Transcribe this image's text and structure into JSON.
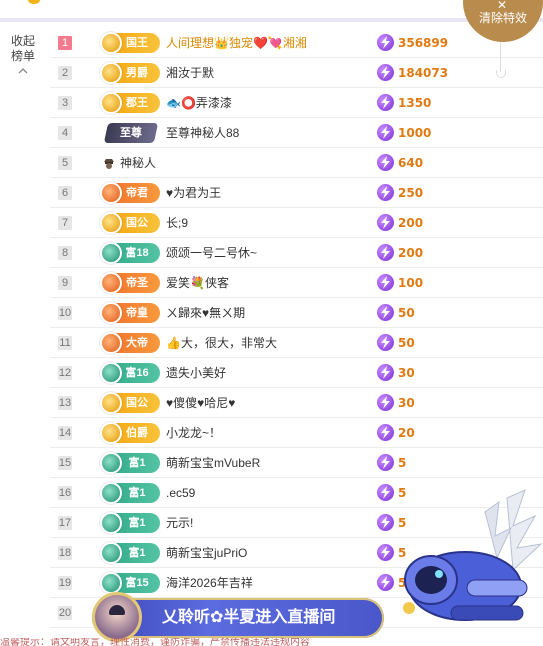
{
  "collapse_label": "收起榜单",
  "clear_effects_label": "清除特效",
  "banner_text": "乂聆听✿半夏进入直播间",
  "bottom_text": "温馨提示：请文明发言，理性消费，谨防诈骗，严禁传播违法违规内容",
  "rows": [
    {
      "rank": "1",
      "badge": "国王",
      "badge_type": "gold",
      "name": "人间理想👑独宠❤️💘湘湘",
      "score": "356899",
      "name_color": "gold"
    },
    {
      "rank": "2",
      "badge": "男爵",
      "badge_type": "gold",
      "name": "湘汝于默",
      "score": "184073"
    },
    {
      "rank": "3",
      "badge": "郡王",
      "badge_type": "gold",
      "name": "🐟⭕弄漆漆",
      "score": "1350"
    },
    {
      "rank": "4",
      "badge": "至尊",
      "badge_type": "dark",
      "name": "至尊神秘人88",
      "score": "1000"
    },
    {
      "rank": "5",
      "badge": "",
      "badge_type": "mystery",
      "name": "神秘人",
      "score": "640"
    },
    {
      "rank": "6",
      "badge": "帝君",
      "badge_type": "orange",
      "name": "♥为君为王",
      "score": "250"
    },
    {
      "rank": "7",
      "badge": "国公",
      "badge_type": "gold",
      "name": "长;9",
      "score": "200"
    },
    {
      "rank": "8",
      "badge": "富18",
      "badge_type": "teal",
      "name": "颂颂一号二号休~",
      "score": "200"
    },
    {
      "rank": "9",
      "badge": "帝圣",
      "badge_type": "orange",
      "name": "爱笑💐侠客",
      "score": "100"
    },
    {
      "rank": "10",
      "badge": "帝皇",
      "badge_type": "orange",
      "name": "ㄨ歸來♥無ㄨ期",
      "score": "50"
    },
    {
      "rank": "11",
      "badge": "大帝",
      "badge_type": "orange",
      "name": "👍大，很大，非常大",
      "score": "50"
    },
    {
      "rank": "12",
      "badge": "富16",
      "badge_type": "teal",
      "name": "遗失小美好",
      "score": "30"
    },
    {
      "rank": "13",
      "badge": "国公",
      "badge_type": "gold",
      "name": "♥傻傻♥哈尼♥",
      "score": "30"
    },
    {
      "rank": "14",
      "badge": "伯爵",
      "badge_type": "gold",
      "name": "小龙龙~！",
      "score": "20"
    },
    {
      "rank": "15",
      "badge": "富1",
      "badge_type": "teal",
      "name": "萌新宝宝mVubeR",
      "score": "5"
    },
    {
      "rank": "16",
      "badge": "富1",
      "badge_type": "teal",
      "name": ".ec59",
      "score": "5"
    },
    {
      "rank": "17",
      "badge": "富1",
      "badge_type": "teal",
      "name": "元示!",
      "score": "5"
    },
    {
      "rank": "18",
      "badge": "富1",
      "badge_type": "teal",
      "name": "萌新宝宝juPriO",
      "score": "5"
    },
    {
      "rank": "19",
      "badge": "富15",
      "badge_type": "teal",
      "name": "海洋2026年吉祥",
      "score": "5"
    },
    {
      "rank": "20",
      "badge": "",
      "badge_type": "none",
      "name": "",
      "score": ""
    }
  ]
}
